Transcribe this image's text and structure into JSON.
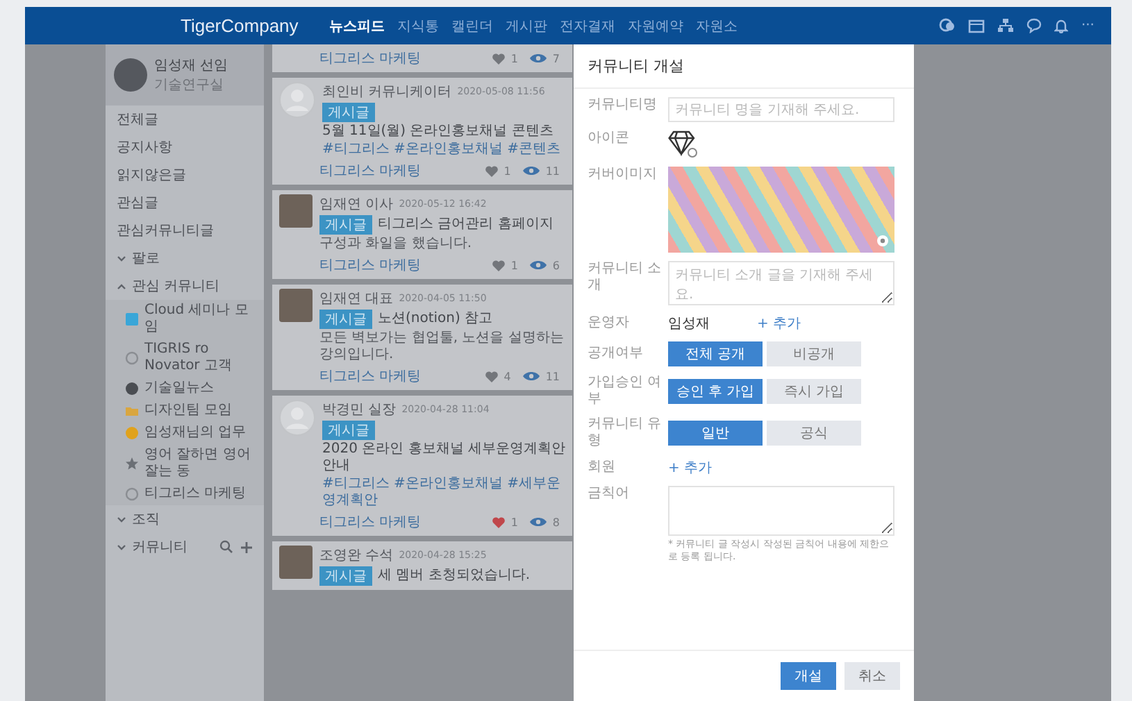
{
  "header": {
    "logo": "TigerCompany",
    "nav": [
      {
        "label": "뉴스피드",
        "selected": true
      },
      {
        "label": "지식통",
        "selected": false
      },
      {
        "label": "캘린더",
        "selected": false
      },
      {
        "label": "게시판",
        "selected": false
      },
      {
        "label": "전자결재",
        "selected": false
      },
      {
        "label": "자원예약",
        "selected": false
      },
      {
        "label": "자원소",
        "selected": false
      }
    ],
    "more": "···"
  },
  "sidebar": {
    "profile": {
      "name": "임성재 선임",
      "dept": "기술연구실"
    },
    "items": [
      "전체글",
      "공지사항",
      "읽지않은글",
      "관심글",
      "관심커뮤니티글"
    ],
    "groups": [
      {
        "label": "팔로",
        "expanded": false
      },
      {
        "label": "관심 커뮤니티",
        "expanded": true,
        "children": [
          {
            "label": "Cloud 세미나 모임",
            "kind": "square",
            "color": "#3aa6d8"
          },
          {
            "label": "TIGRIS ro Novator 고객",
            "kind": "ring",
            "color": "#8a8d92"
          },
          {
            "label": "기술일뉴스",
            "kind": "dot",
            "color": "#4a4d52"
          },
          {
            "label": "디자인팀 모임",
            "kind": "folder",
            "color": "#d9a640"
          },
          {
            "label": "임성재님의 업무",
            "kind": "dot",
            "color": "#e0a21c"
          },
          {
            "label": "영어 잘하면 영어 잘는 동",
            "kind": "star",
            "color": "#6b6f75"
          },
          {
            "label": "티그리스 마케팅",
            "kind": "ring",
            "color": "#8a8d92"
          }
        ]
      },
      {
        "label": "조직",
        "expanded": false
      },
      {
        "label": "커뮤니티",
        "expanded": false,
        "tools": true
      }
    ]
  },
  "posts": [
    {
      "footer": {
        "community": "티그리스 마케팅",
        "likes": "1",
        "views": "7",
        "liked": false
      }
    },
    {
      "kind": "default",
      "author": "최인비 커뮤니케이터",
      "date": "2020-05-08 11:56",
      "badge": "게시글",
      "title": "5월 11일(월) 온라인홍보채널 콘텐츠",
      "tags": "#티그리스 #온라인홍보채널 #콘텐츠",
      "footer": {
        "community": "티그리스 마케팅",
        "likes": "1",
        "views": "11",
        "liked": false
      }
    },
    {
      "kind": "photo",
      "author": "임재연 이사",
      "date": "2020-05-12 16:42",
      "badge": "게시글",
      "title": "티그리스 금어관리 홈페이지",
      "body": "구성과 화일을 했습니다.",
      "footer": {
        "community": "티그리스 마케팅",
        "likes": "1",
        "views": "6",
        "liked": false
      }
    },
    {
      "kind": "photo",
      "author": "임재연 대표",
      "date": "2020-04-05 11:50",
      "badge": "게시글",
      "title": "노션(notion) 참고",
      "body": "모든 벽보가는 협업툴, 노션을 설명하는 강의입니다.",
      "footer": {
        "community": "티그리스 마케팅",
        "likes": "4",
        "views": "11",
        "liked": false
      }
    },
    {
      "kind": "default",
      "author": "박경민 실장",
      "date": "2020-04-28 11:04",
      "badge": "게시글",
      "title": "2020 온라인 홍보채널 세부운영계획안 안내",
      "tags": "#티그리스 #온라인홍보채널 #세부운영계획안",
      "footer": {
        "community": "티그리스 마케팅",
        "likes": "1",
        "views": "8",
        "liked": true
      }
    },
    {
      "kind": "photo",
      "author": "조영완 수석",
      "date": "2020-04-28 15:25",
      "badge": "게시글",
      "title": "세 멤버 초청되었습니다."
    }
  ],
  "modal": {
    "title": "커뮤니티 개설",
    "name": {
      "label": "커뮤니티명",
      "placeholder": "커뮤니티 명을 기재해 주세요."
    },
    "icon": {
      "label": "아이콘"
    },
    "cover": {
      "label": "커버이미지"
    },
    "intro": {
      "label": "커뮤니티 소개",
      "placeholder": "커뮤니티 소개 글을 기재해 주세요."
    },
    "operator": {
      "label": "운영자",
      "value": "임성재",
      "add": "+ 추가"
    },
    "choices": [
      {
        "label": "공개여부",
        "options": [
          {
            "label": "전체 공개",
            "selected": true
          },
          {
            "label": "비공개",
            "selected": false
          }
        ]
      },
      {
        "label": "가입승인 여부",
        "options": [
          {
            "label": "승인 후 가입",
            "selected": true
          },
          {
            "label": "즉시 가입",
            "selected": false
          }
        ]
      },
      {
        "label": "커뮤니티 유형",
        "options": [
          {
            "label": "일반",
            "selected": true
          },
          {
            "label": "공식",
            "selected": false
          }
        ]
      }
    ],
    "members": {
      "label": "회원",
      "add": "+ 추가"
    },
    "banned": {
      "label": "금칙어",
      "note": "* 커뮤니티 글 작성시 작성된 금칙어 내용에 제한으로 등록 됩니다."
    },
    "buttons": [
      {
        "label": "개설",
        "kind": "primary"
      },
      {
        "label": "취소",
        "kind": "secondary"
      }
    ]
  }
}
